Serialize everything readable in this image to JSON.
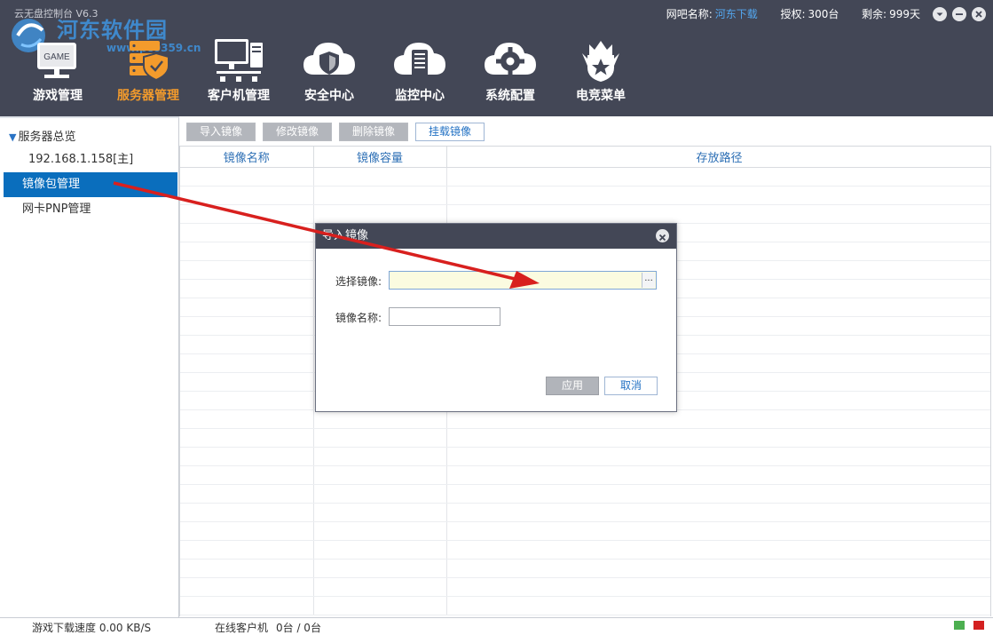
{
  "app": {
    "title": "云无盘控制台 V6.3",
    "watermark_text": "河东软件园",
    "watermark_url": "www.pc0359.cn"
  },
  "top_info": {
    "cafe_label": "网吧名称:",
    "cafe_value": "河东下载",
    "license_label": "授权:",
    "license_value": "300台",
    "remaining_label": "剩余:",
    "remaining_value": "999天"
  },
  "nav": {
    "items": [
      {
        "label": "游戏管理",
        "icon": "game-monitor-icon",
        "icon_text": "GAME"
      },
      {
        "label": "服务器管理",
        "icon": "server-shield-icon"
      },
      {
        "label": "客户机管理",
        "icon": "client-computer-icon"
      },
      {
        "label": "安全中心",
        "icon": "cloud-shield-icon"
      },
      {
        "label": "监控中心",
        "icon": "cloud-server-icon"
      },
      {
        "label": "系统配置",
        "icon": "cloud-gear-icon"
      },
      {
        "label": "电竞菜单",
        "icon": "crown-star-icon"
      }
    ],
    "active_index": 1
  },
  "sidebar": {
    "head": "服务器总览",
    "items": [
      {
        "label": "192.168.1.158[主]"
      },
      {
        "label": "镜像包管理"
      },
      {
        "label": "网卡PNP管理"
      }
    ],
    "selected_index": 1
  },
  "toolbar": {
    "import_label": "导入镜像",
    "modify_label": "修改镜像",
    "delete_label": "删除镜像",
    "mount_label": "挂载镜像"
  },
  "table": {
    "columns": [
      "镜像名称",
      "镜像容量",
      "存放路径"
    ],
    "rows": []
  },
  "statusbar": {
    "download_speed": "游戏下载速度 0.00 KB/S",
    "online_label": "在线客户机",
    "online_value": "0台 / 0台"
  },
  "dialog": {
    "title": "导入镜像",
    "select_label": "选择镜像:",
    "select_value": "",
    "browse_label": "...",
    "name_label": "镜像名称:",
    "name_value": "",
    "apply_label": "应用",
    "cancel_label": "取消"
  },
  "colors": {
    "header_bg": "#434756",
    "active_nav": "#f39b2c",
    "selection_blue": "#0a6ebd",
    "link_blue": "#53a7f0",
    "arrow_red": "#d8201e",
    "led_green": "#4caf50",
    "led_red": "#d32020"
  }
}
